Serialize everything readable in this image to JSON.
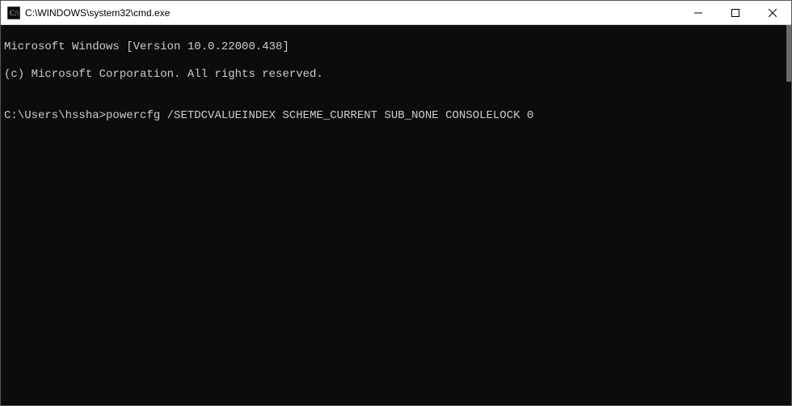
{
  "titlebar": {
    "title": "C:\\WINDOWS\\system32\\cmd.exe",
    "icon_name": "cmd-icon"
  },
  "terminal": {
    "line1": "Microsoft Windows [Version 10.0.22000.438]",
    "line2": "(c) Microsoft Corporation. All rights reserved.",
    "blank": "",
    "prompt": "C:\\Users\\hssha>",
    "command": "powercfg /SETDCVALUEINDEX SCHEME_CURRENT SUB_NONE CONSOLELOCK 0"
  }
}
